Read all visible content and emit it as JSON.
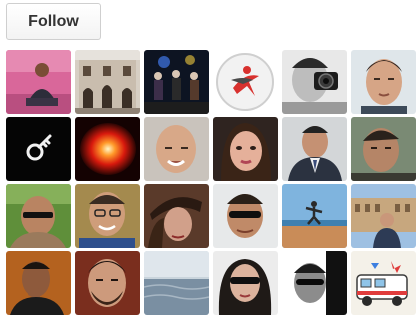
{
  "follow_button": {
    "label": "Follow"
  },
  "followers": [
    {
      "avatar": "person-pink-wall"
    },
    {
      "avatar": "building-facade"
    },
    {
      "avatar": "band-on-stage"
    },
    {
      "avatar": "runner-logo"
    },
    {
      "avatar": "photographer-with-camera"
    },
    {
      "avatar": "man-portrait"
    },
    {
      "avatar": "key-icon"
    },
    {
      "avatar": "red-explosion"
    },
    {
      "avatar": "bald-man-smiling"
    },
    {
      "avatar": "woman-portrait"
    },
    {
      "avatar": "man-in-suit"
    },
    {
      "avatar": "man-portrait-dark"
    },
    {
      "avatar": "man-with-sunglasses-outdoor"
    },
    {
      "avatar": "man-smiling"
    },
    {
      "avatar": "woman-with-hat"
    },
    {
      "avatar": "man-with-sunglasses"
    },
    {
      "avatar": "person-on-beach"
    },
    {
      "avatar": "man-at-colosseum"
    },
    {
      "avatar": "man-hand-on-chin"
    },
    {
      "avatar": "man-bearded"
    },
    {
      "avatar": "sea-landscape"
    },
    {
      "avatar": "woman-with-sunglasses"
    },
    {
      "avatar": "man-with-sunglasses-bw"
    },
    {
      "avatar": "cartoon-camper-van"
    }
  ]
}
